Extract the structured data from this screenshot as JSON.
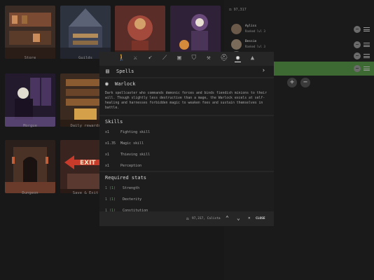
{
  "grid": {
    "tiles": [
      {
        "label": "Store",
        "colors": [
          "#3b2c25",
          "#7a4a33",
          "#c98c5a"
        ]
      },
      {
        "label": "Guilds",
        "colors": [
          "#2e3340",
          "#5b6275",
          "#b38c5a"
        ]
      },
      {
        "label": "",
        "colors": [
          "#5a2d28",
          "#a34a3c",
          "#d4a06a"
        ]
      },
      {
        "label": "",
        "colors": [
          "#2f2238",
          "#6a4a7a",
          "#d38a3a"
        ]
      },
      {
        "label": "Morgue",
        "colors": [
          "#231a2e",
          "#4a3560",
          "#8a6ab0"
        ]
      },
      {
        "label": "Daily rewards",
        "colors": [
          "#3a2a20",
          "#8a5a30",
          "#d4a04a"
        ]
      },
      {
        "label": "Dungeon",
        "colors": [
          "#2a1f1a",
          "#6a3a2a",
          "#c0603a"
        ]
      },
      {
        "label": "Save & Exit",
        "colors": [
          "#3a2420",
          "#8a3a2a",
          "#d8b090"
        ]
      }
    ]
  },
  "party": {
    "money": "97,317",
    "members": [
      {
        "name": "Ayliss",
        "sub": "Ranked lvl 3"
      },
      {
        "name": "Bessie",
        "sub": "Ranked lvl 3"
      },
      {
        "name": "",
        "sub": ""
      },
      {
        "name": "",
        "sub": ""
      }
    ],
    "add_label": "+",
    "remove_label": "−"
  },
  "modal": {
    "tabs": [
      {
        "icon": "walker-icon"
      },
      {
        "icon": "crossed-swords-icon"
      },
      {
        "icon": "bow-icon"
      },
      {
        "icon": "staff-icon"
      },
      {
        "icon": "chest-icon"
      },
      {
        "icon": "shield-icon"
      },
      {
        "icon": "axe-icon"
      },
      {
        "icon": "helmet-icon"
      },
      {
        "icon": "eye-icon"
      },
      {
        "icon": "wizard-hat-icon"
      }
    ],
    "spells_label": "Spells",
    "class_name": "Warlock",
    "description": "Dark spellcaster who commands demonic forces and binds fiendish minions to their will. Though slightly less destructive than a mage, the Warlock excels at self-healing and harnesses forbidden magic to weaken foes and sustain themselves in battle.",
    "skills_title": "Skills",
    "skills": [
      {
        "mult": "x1",
        "name": "Fighting skill"
      },
      {
        "mult": "x1.35",
        "name": "Magic skill"
      },
      {
        "mult": "x1",
        "name": "Thieving skill"
      },
      {
        "mult": "x1",
        "name": "Perception"
      }
    ],
    "stats_title": "Required stats",
    "stats": [
      {
        "lvl": "1 (1)",
        "name": "Strength"
      },
      {
        "lvl": "1 (1)",
        "name": "Dexterity"
      },
      {
        "lvl": "1 (1)",
        "name": "Constitution"
      }
    ],
    "footer": {
      "money_text": "97,317, Calista",
      "close_label": "CLOSE"
    }
  }
}
